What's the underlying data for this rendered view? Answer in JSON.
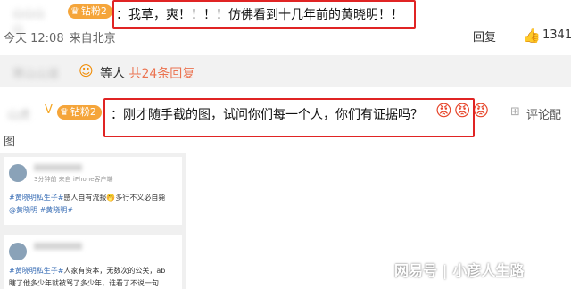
{
  "comment1": {
    "username": "山山山山",
    "badge": "钻粉2",
    "text": "：我草，爽！！！！仿佛看到十几年前的黄晓明！！",
    "time": "今天 12:08",
    "location": "来自北京",
    "reply_label": "回复",
    "like_count": "1341"
  },
  "replies": {
    "username": "寒山山道",
    "label": "等人",
    "count": "共24条回复"
  },
  "comment2": {
    "username": "山虎",
    "badge": "钻粉2",
    "text": "：刚才随手截的图，试问你们每一个人，你们有证据吗？",
    "emojis": "😡😡😡",
    "image_label": "评论配",
    "image_label_cont": "图"
  },
  "screenshot": {
    "post1": {
      "sub": "3分钟前  来自 iPhone客户端",
      "line1_tag": "#黄晓明私生子#",
      "line1_rest": "感人自有流报🤭多行不义必自毙",
      "line2_tag": "@黄晓明 #黄晓明#"
    },
    "post2": {
      "line1_tag": "#黄晓明私生子#",
      "line1_rest": "人家有资本，无数次的公关，ab",
      "line2": "瞎了他多少年就被骂了多少年，谁看了不说一句"
    }
  },
  "watermark": {
    "brand": "网易号",
    "separator": "|",
    "author": "小彦人生路"
  },
  "colors": {
    "highlight_box": "#e02424",
    "badge_bg": "#f5a53a",
    "reply_count": "#eb7350",
    "hashtag": "#3b6fb6"
  }
}
